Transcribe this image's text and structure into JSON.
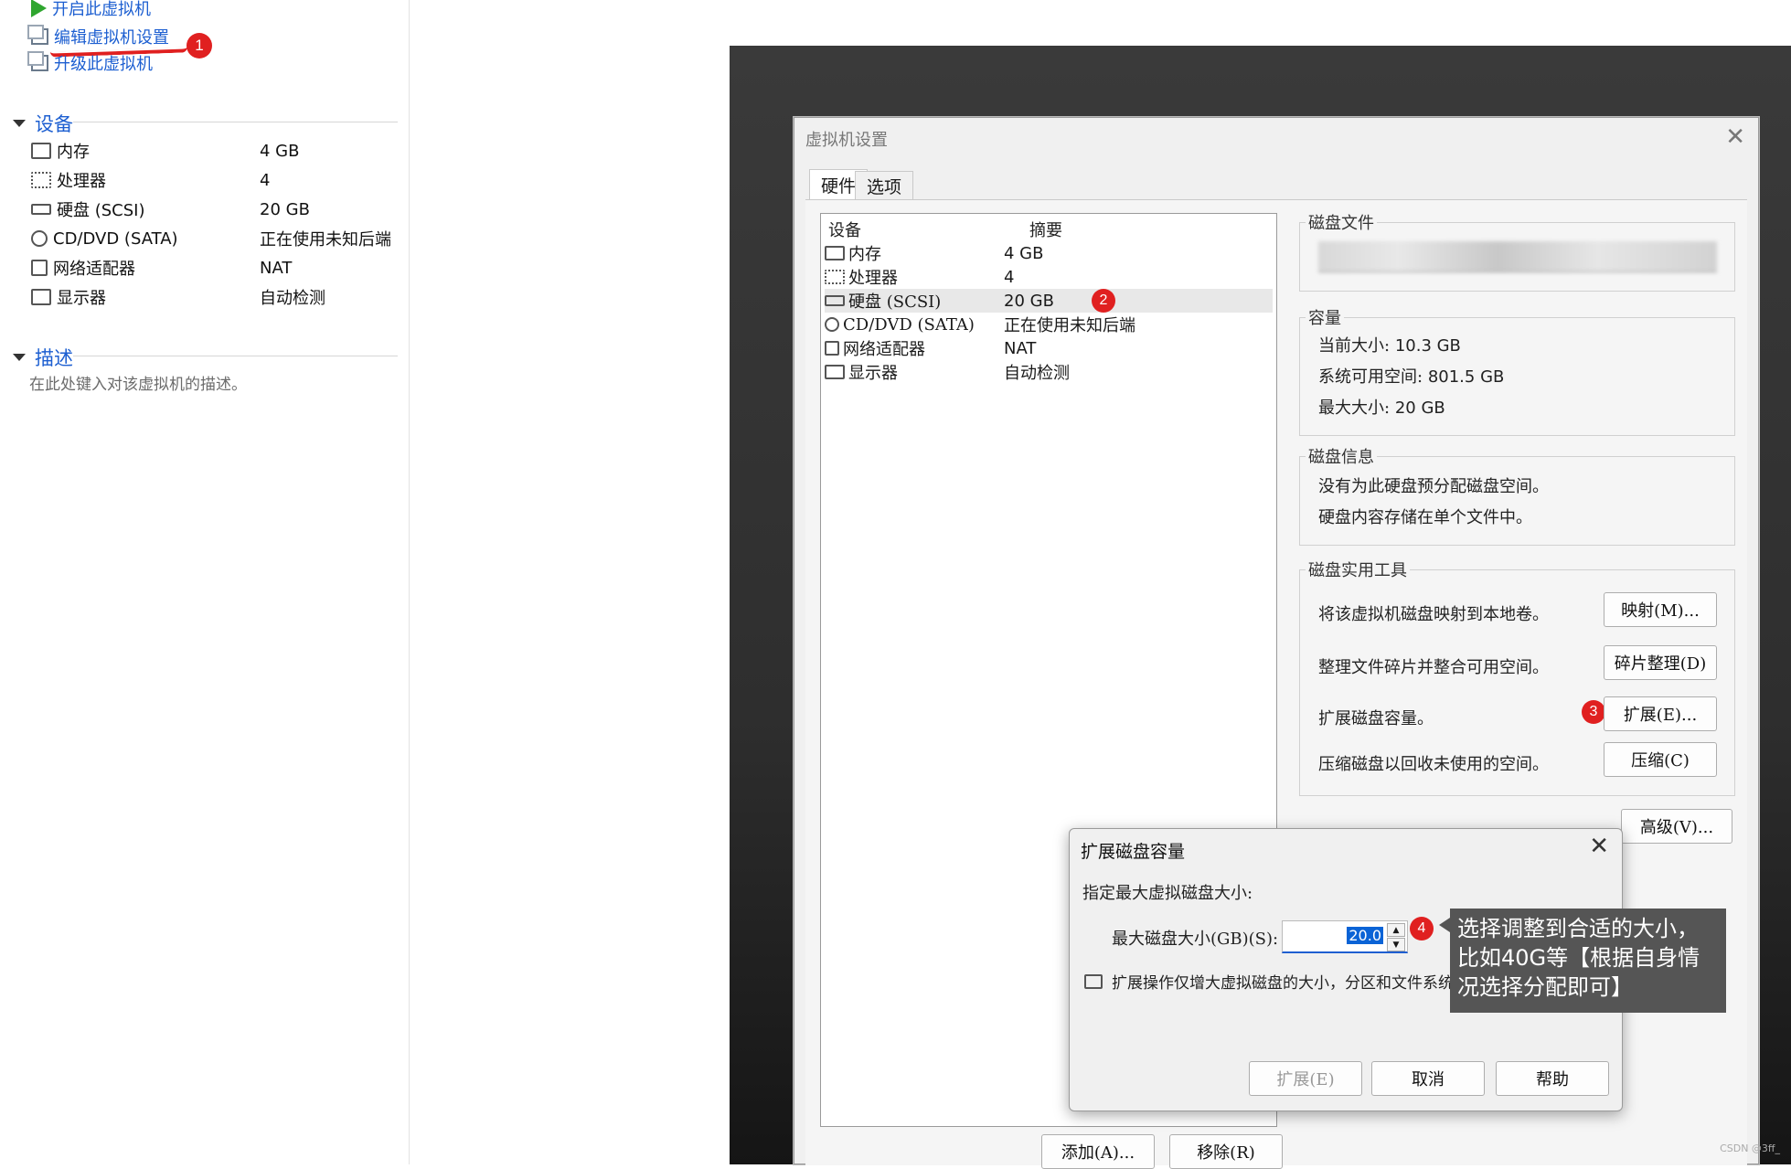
{
  "sidebar": {
    "actions": [
      {
        "label": "开启此虚拟机",
        "icon": "play-icon"
      },
      {
        "label": "编辑虚拟机设置",
        "icon": "edit-settings-icon"
      },
      {
        "label": "升级此虚拟机",
        "icon": "upgrade-icon"
      }
    ],
    "devices_header": "设备",
    "devices": [
      {
        "name": "内存",
        "value": "4 GB",
        "icon": "memory-icon"
      },
      {
        "name": "处理器",
        "value": "4",
        "icon": "cpu-icon"
      },
      {
        "name": "硬盘 (SCSI)",
        "value": "20 GB",
        "icon": "hard-disk-icon"
      },
      {
        "name": "CD/DVD (SATA)",
        "value": "正在使用未知后端",
        "icon": "cd-dvd-icon"
      },
      {
        "name": "网络适配器",
        "value": "NAT",
        "icon": "network-adapter-icon"
      },
      {
        "name": "显示器",
        "value": "自动检测",
        "icon": "display-icon"
      }
    ],
    "description_header": "描述",
    "description_placeholder": "在此处键入对该虚拟机的描述。"
  },
  "annotations": {
    "badge1": "1",
    "badge2": "2",
    "badge3": "3",
    "badge4": "4",
    "tooltip": "选择调整到合适的大小，比如40G等【根据自身情况选择分配即可】"
  },
  "settings_dialog": {
    "title": "虚拟机设置",
    "tabs": [
      "硬件",
      "选项"
    ],
    "list_headers": {
      "device": "设备",
      "summary": "摘要"
    },
    "devices": [
      {
        "name": "内存",
        "summary": "4 GB"
      },
      {
        "name": "处理器",
        "summary": "4"
      },
      {
        "name": "硬盘 (SCSI)",
        "summary": "20 GB"
      },
      {
        "name": "CD/DVD (SATA)",
        "summary": "正在使用未知后端"
      },
      {
        "name": "网络适配器",
        "summary": "NAT"
      },
      {
        "name": "显示器",
        "summary": "自动检测"
      }
    ],
    "disk_file_label": "磁盘文件",
    "capacity": {
      "label": "容量",
      "current_label": "当前大小:",
      "current": "10.3 GB",
      "free_label": "系统可用空间:",
      "free": "801.5 GB",
      "max_label": "最大大小:",
      "max": "20 GB"
    },
    "disk_info": {
      "label": "磁盘信息",
      "line1": "没有为此硬盘预分配磁盘空间。",
      "line2": "硬盘内容存储在单个文件中。"
    },
    "utilities": {
      "label": "磁盘实用工具",
      "map_text": "将该虚拟机磁盘映射到本地卷。",
      "map_btn": "映射(M)...",
      "defrag_text": "整理文件碎片并整合可用空间。",
      "defrag_btn": "碎片整理(D)",
      "expand_text": "扩展磁盘容量。",
      "expand_btn": "扩展(E)...",
      "compact_text": "压缩磁盘以回收未使用的空间。",
      "compact_btn": "压缩(C)"
    },
    "advanced_btn": "高级(V)...",
    "add_btn": "添加(A)...",
    "remove_btn": "移除(R)"
  },
  "expand_dialog": {
    "title": "扩展磁盘容量",
    "heading": "指定最大虚拟磁盘大小:",
    "size_label": "最大磁盘大小(GB)(S):",
    "size_value": "20.0",
    "note": "扩展操作仅增大虚拟磁盘的大小，分区和文件系统的大小不受影响。",
    "expand_btn": "扩展(E)",
    "cancel_btn": "取消",
    "help_btn": "帮助"
  },
  "watermark": "CSDN @3ff_"
}
